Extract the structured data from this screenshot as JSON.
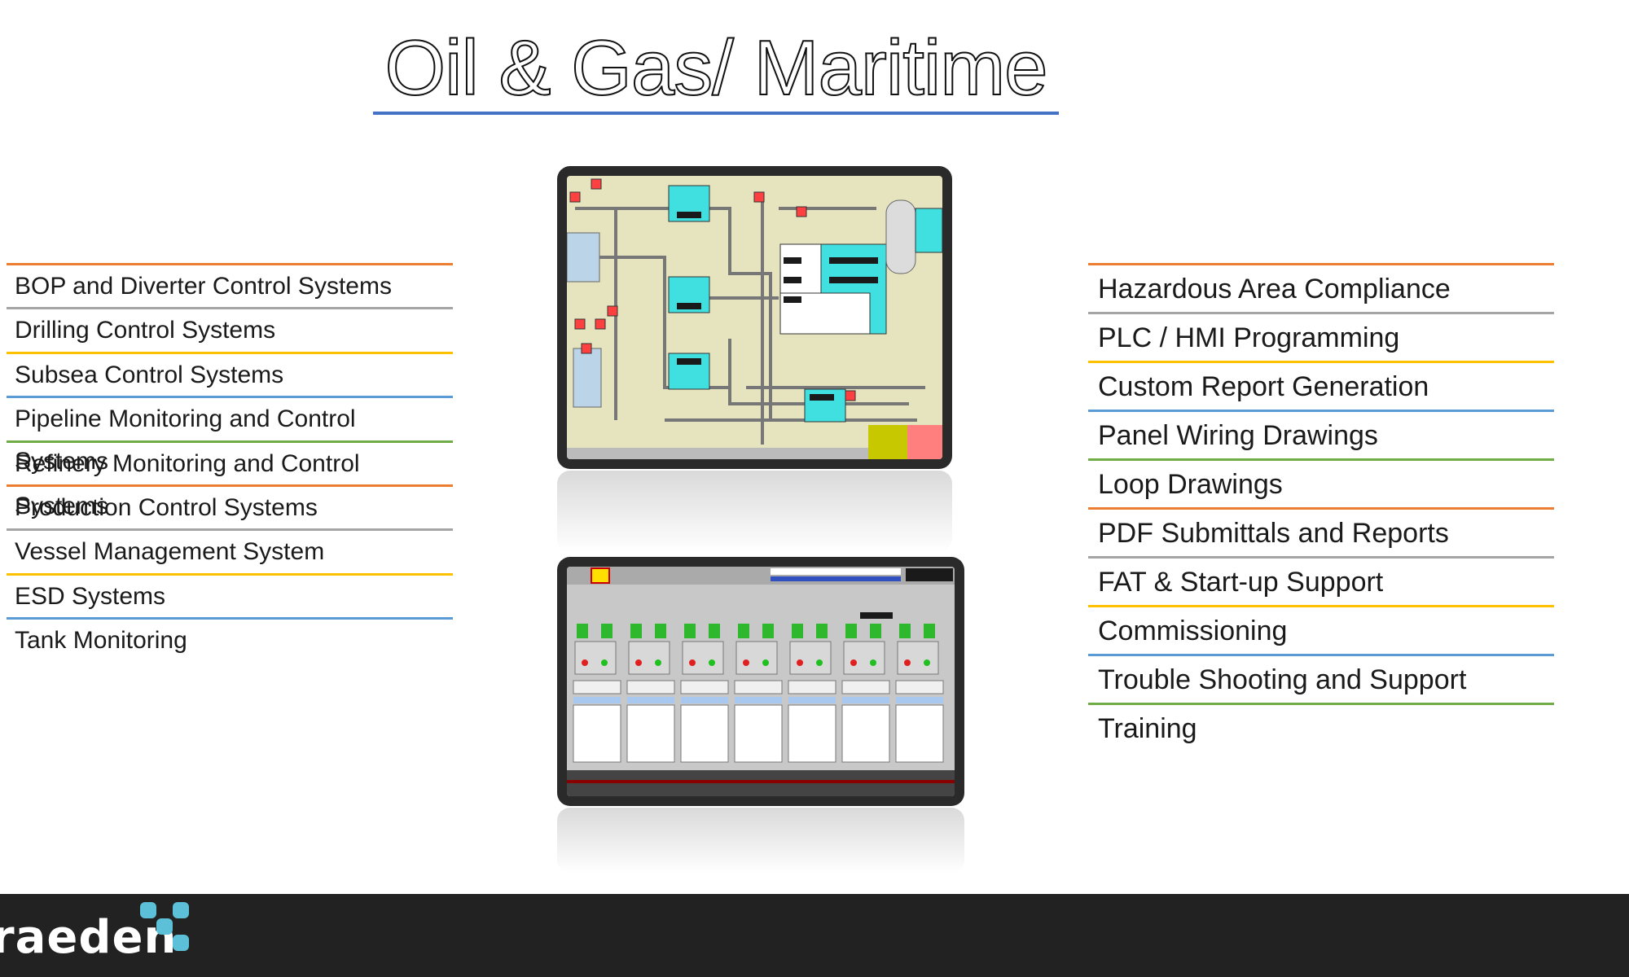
{
  "title": "Oil & Gas/ Maritime",
  "left_items": [
    "BOP and Diverter Control Systems",
    "Drilling Control Systems",
    "Subsea Control Systems",
    "Pipeline Monitoring and Control Systems",
    "Refinery Monitoring and Control Systems",
    "Production Control Systems",
    "Vessel Management System",
    "ESD Systems",
    "Tank Monitoring"
  ],
  "right_items": [
    "Hazardous Area Compliance",
    "PLC / HMI Programming",
    "Custom Report Generation",
    "Panel Wiring Drawings",
    "Loop Drawings",
    "PDF Submittals and Reports",
    "FAT & Start-up Support",
    "Commissioning",
    "Trouble Shooting and Support",
    "Training"
  ],
  "rule_colors_left": [
    "#ed7d31",
    "#a5a5a5",
    "#ffc000",
    "#5b9bd5",
    "#70ad47",
    "#ed7d31",
    "#a5a5a5",
    "#ffc000",
    "#5b9bd5"
  ],
  "rule_colors_right": [
    "#ed7d31",
    "#a5a5a5",
    "#ffc000",
    "#5b9bd5",
    "#70ad47",
    "#ed7d31",
    "#a5a5a5",
    "#ffc000",
    "#5b9bd5",
    "#70ad47"
  ],
  "colors": {
    "title_underline": "#4472c4",
    "footer_bg": "#222222",
    "logo_accent": "#5bc0d8"
  },
  "screen1": {
    "description_icon": "process-hmi-screenshot"
  },
  "screen2": {
    "description_icon": "loading-station-hmi-screenshot"
  },
  "footer": {
    "logo_text": "raeden"
  }
}
